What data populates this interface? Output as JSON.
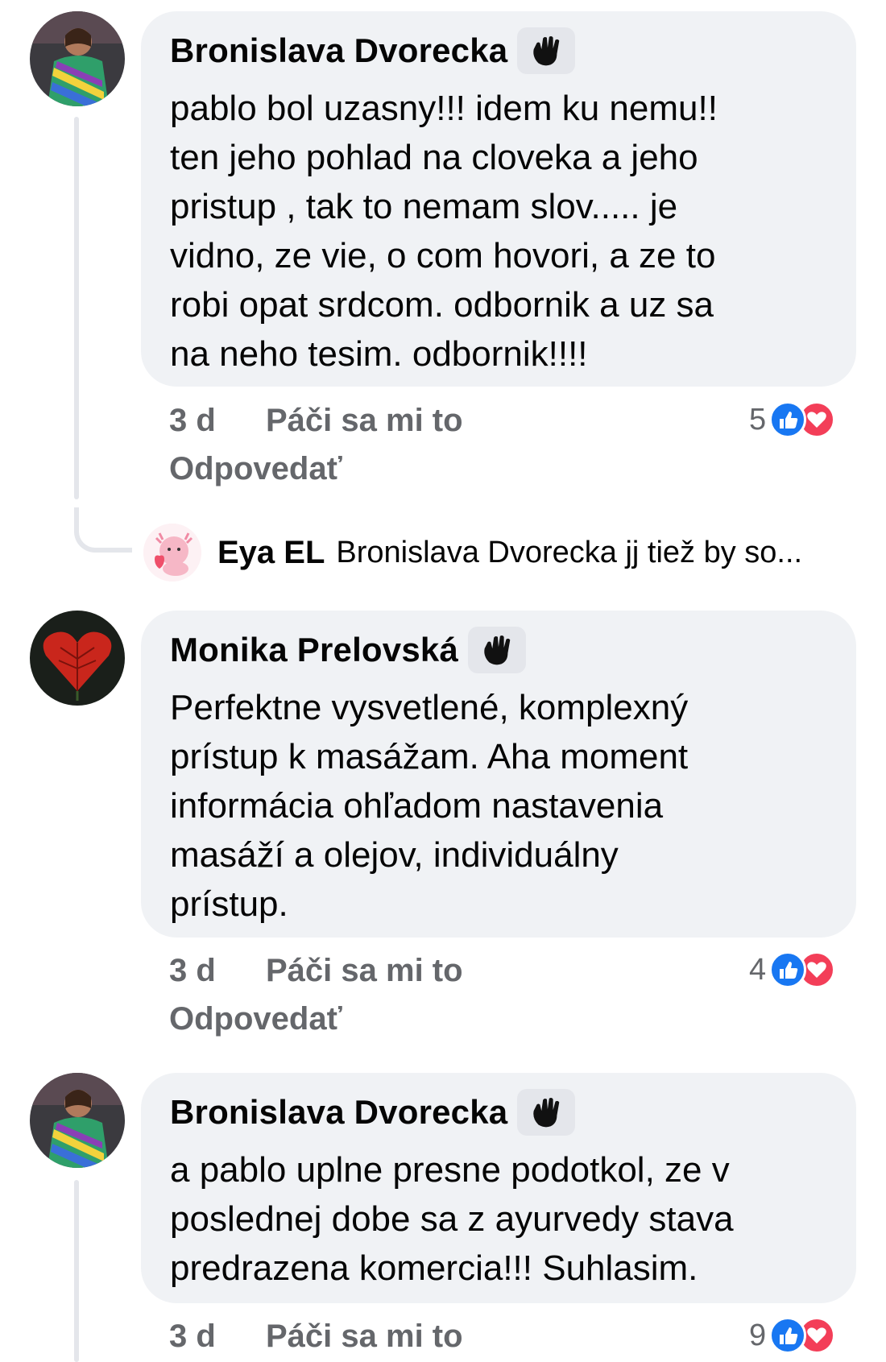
{
  "colors": {
    "bubble_bg": "#f0f2f5",
    "meta_text": "#65676b",
    "like_blue": "#1877f2",
    "love_red": "#f33e58"
  },
  "comments": [
    {
      "author": "Bronislava Dvorecka",
      "badge_icon": "waving-hand-icon",
      "text": "pablo bol uzasny!!! idem ku nemu!!\nten jeho pohlad na cloveka a jeho\npristup , tak to nemam slov..... je\nvidno, ze vie, o com hovori, a ze to\nrobi opat srdcom. odbornik a uz sa\nna neho tesim. odbornik!!!!",
      "time": "3 d",
      "like_label": "Páči sa mi to",
      "reply_label": "Odpovedať",
      "reaction_count": "5",
      "reply_preview": {
        "name": "Eya EL",
        "text": "Bronislava Dvorecka jj tiež by so..."
      }
    },
    {
      "author": "Monika Prelovská",
      "badge_icon": "waving-hand-icon",
      "text": "Perfektne vysvetlené, komplexný\nprístup k masážam. Aha moment\ninformácia ohľadom nastavenia\nmasáží a olejov, individuálny\nprístup.",
      "time": "3 d",
      "like_label": "Páči sa mi to",
      "reply_label": "Odpovedať",
      "reaction_count": "4"
    },
    {
      "author": "Bronislava Dvorecka",
      "badge_icon": "waving-hand-icon",
      "text": "a pablo uplne presne podotkol, ze v\nposlednej dobe sa z ayurvedy stava\npredrazena komercia!!! Suhlasim.",
      "time": "3 d",
      "like_label": "Páči sa mi to",
      "reaction_count": "9"
    }
  ]
}
